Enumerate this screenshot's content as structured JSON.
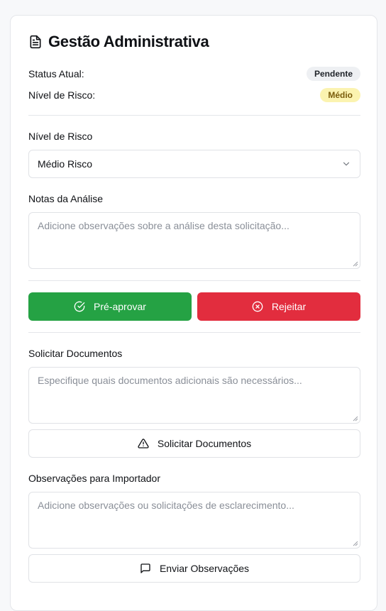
{
  "header": {
    "title": "Gestão Administrativa",
    "icon": "document-icon"
  },
  "status": {
    "status_label": "Status Atual:",
    "status_value": "Pendente",
    "risk_label": "Nível de Risco:",
    "risk_value": "Médio"
  },
  "risk_select": {
    "label": "Nível de Risco",
    "selected": "Médio Risco"
  },
  "analysis_notes": {
    "label": "Notas da Análise",
    "placeholder": "Adicione observações sobre a análise desta solicitação..."
  },
  "actions": {
    "approve_label": "Pré-aprovar",
    "reject_label": "Rejeitar"
  },
  "request_docs": {
    "label": "Solicitar Documentos",
    "placeholder": "Especifique quais documentos adicionais são necessários...",
    "button_label": "Solicitar Documentos"
  },
  "importer_notes": {
    "label": "Observações para Importador",
    "placeholder": "Adicione observações ou solicitações de esclarecimento...",
    "button_label": "Enviar Observações"
  },
  "colors": {
    "approve": "#25a244",
    "reject": "#e22d3e",
    "badge_pending_bg": "#eef0f3",
    "badge_medium_bg": "#fbf3b0"
  }
}
